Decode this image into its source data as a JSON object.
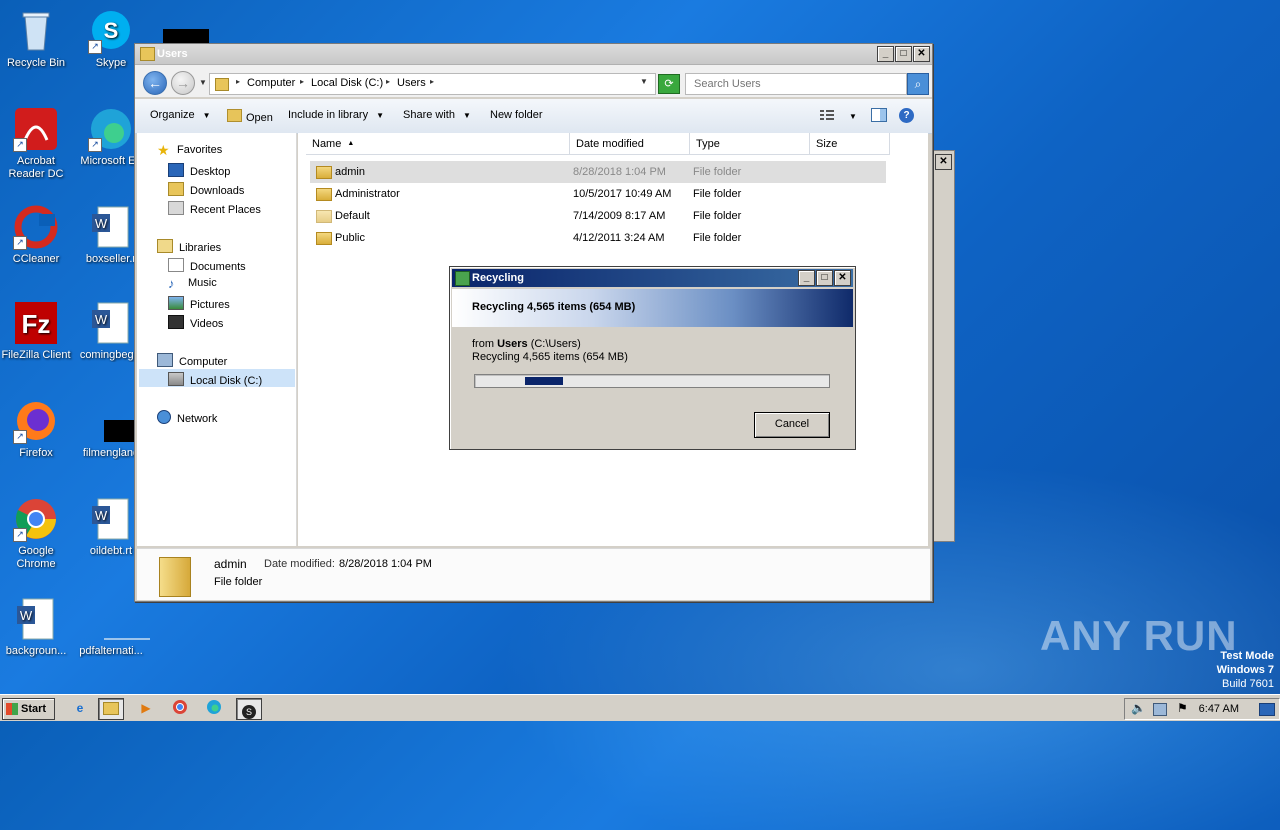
{
  "desktop": {
    "icons": [
      {
        "label": "Recycle Bin"
      },
      {
        "label": "Skype"
      },
      {
        "label": "Acrobat Reader DC"
      },
      {
        "label": "Microsoft Ed"
      },
      {
        "label": "CCleaner"
      },
      {
        "label": "boxseller.r"
      },
      {
        "label": "FileZilla Client"
      },
      {
        "label": "comingbegin"
      },
      {
        "label": "Firefox"
      },
      {
        "label": "filmengland"
      },
      {
        "label": "Google Chrome"
      },
      {
        "label": "oildebt.rt"
      },
      {
        "label": "backgroun..."
      },
      {
        "label": "pdfalternati..."
      }
    ],
    "watermark": "ANY RUN",
    "testmode": {
      "line1": "Test Mode",
      "line2": "Windows 7",
      "line3": "Build 7601"
    }
  },
  "explorer": {
    "title": "Users",
    "breadcrumb": [
      "Computer",
      "Local Disk (C:)",
      "Users"
    ],
    "search_placeholder": "Search Users",
    "toolbar": {
      "organize": "Organize",
      "open": "Open",
      "include": "Include in library",
      "share": "Share with",
      "new_folder": "New folder"
    },
    "nav": {
      "favorites": "Favorites",
      "desktop": "Desktop",
      "downloads": "Downloads",
      "recent": "Recent Places",
      "libraries": "Libraries",
      "documents": "Documents",
      "music": "Music",
      "pictures": "Pictures",
      "videos": "Videos",
      "computer": "Computer",
      "local_disk": "Local Disk (C:)",
      "network": "Network"
    },
    "columns": {
      "name": "Name",
      "date": "Date modified",
      "type": "Type",
      "size": "Size"
    },
    "rows": [
      {
        "name": "admin",
        "date": "8/28/2018 1:04 PM",
        "type": "File folder"
      },
      {
        "name": "Administrator",
        "date": "10/5/2017 10:49 AM",
        "type": "File folder"
      },
      {
        "name": "Default",
        "date": "7/14/2009 8:17 AM",
        "type": "File folder"
      },
      {
        "name": "Public",
        "date": "4/12/2011 3:24 AM",
        "type": "File folder"
      }
    ],
    "details": {
      "name": "admin",
      "modified_label": "Date modified:",
      "modified_value": "8/28/2018 1:04 PM",
      "type": "File folder"
    }
  },
  "dialog": {
    "title": "Recycling",
    "header": "Recycling 4,565 items (654 MB)",
    "from_prefix": "from",
    "from_bold": "Users",
    "from_path": "(C:\\Users)",
    "status": "Recycling 4,565 items (654 MB)",
    "cancel": "Cancel"
  },
  "taskbar": {
    "start": "Start",
    "clock": "6:47 AM"
  }
}
